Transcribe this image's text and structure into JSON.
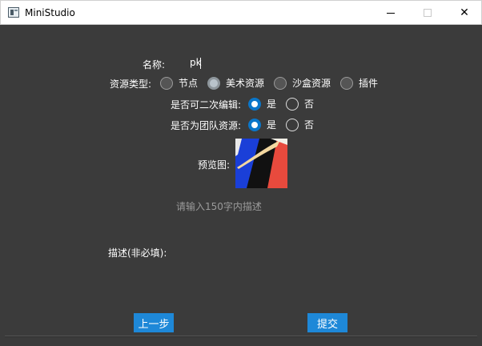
{
  "window": {
    "title": "MiniStudio",
    "controls": {
      "minimize": "—",
      "maximize": "☐",
      "close": "✕"
    }
  },
  "form": {
    "name": {
      "label": "名称:",
      "value": "pk"
    },
    "resource_type": {
      "label": "资源类型:",
      "options": [
        "节点",
        "美术资源",
        "沙盒资源",
        "插件"
      ],
      "selected": "美术资源"
    },
    "editable": {
      "label": "是否可二次编辑:",
      "options": [
        "是",
        "否"
      ],
      "selected": "是"
    },
    "team_resource": {
      "label": "是否为团队资源:",
      "options": [
        "是",
        "否"
      ],
      "selected": "是"
    },
    "preview": {
      "label": "预览图:"
    },
    "description": {
      "label": "描述(非必填):",
      "placeholder": "请输入150字内描述"
    }
  },
  "buttons": {
    "prev": "上一步",
    "submit": "提交"
  },
  "colors": {
    "background": "#3b3b3b",
    "accent": "#1e88d8",
    "radio_checked": "#0a76c9"
  }
}
